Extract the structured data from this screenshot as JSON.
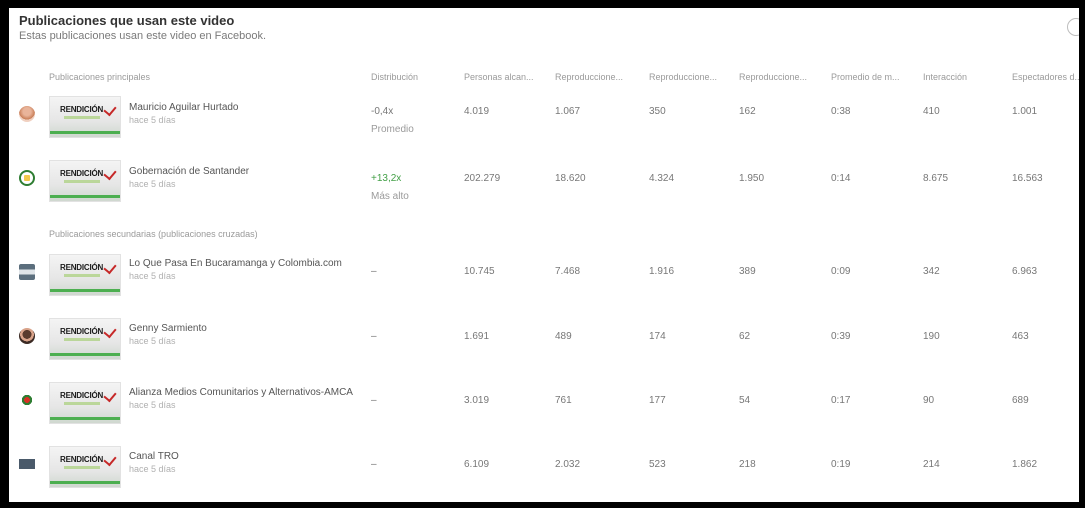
{
  "header": {
    "title": "Publicaciones que usan este video",
    "subtitle": "Estas publicaciones usan este video en Facebook."
  },
  "columns": [
    "Publicaciones principales",
    "Distribución",
    "Personas alcan...",
    "Reproduccione...",
    "Reproduccione...",
    "Reproduccione...",
    "Promedio de m...",
    "Interacción",
    "Espectadores d..."
  ],
  "primary_posts": [
    {
      "name": "Mauricio Aguilar Hurtado",
      "time": "hace 5 días",
      "thumb_text": "RENDICIÓN",
      "distribution": "-0,4x",
      "distribution_note": "Promedio",
      "values": [
        "4.019",
        "1.067",
        "350",
        "162",
        "0:38",
        "410",
        "1.001"
      ]
    },
    {
      "name": "Gobernación de Santander",
      "time": "hace 5 días",
      "thumb_text": "RENDICIÓN",
      "distribution": "+13,2x",
      "distribution_note": "Más alto",
      "values": [
        "202.279",
        "18.620",
        "4.324",
        "1.950",
        "0:14",
        "8.675",
        "16.563"
      ]
    }
  ],
  "secondary_label": "Publicaciones secundarias (publicaciones cruzadas)",
  "secondary_posts": [
    {
      "name": "Lo Que Pasa En Bucaramanga y Colombia.com",
      "time": "hace 5 días",
      "thumb_text": "RENDICIÓN",
      "distribution": "–",
      "values": [
        "10.745",
        "7.468",
        "1.916",
        "389",
        "0:09",
        "342",
        "6.963"
      ]
    },
    {
      "name": "Genny Sarmiento",
      "time": "hace 5 días",
      "thumb_text": "RENDICIÓN",
      "distribution": "–",
      "values": [
        "1.691",
        "489",
        "174",
        "62",
        "0:39",
        "190",
        "463"
      ]
    },
    {
      "name": "Alianza Medios Comunitarios y Alternativos-AMCA",
      "time": "hace 5 días",
      "thumb_text": "RENDICIÓN",
      "distribution": "–",
      "values": [
        "3.019",
        "761",
        "177",
        "54",
        "0:17",
        "90",
        "689"
      ]
    },
    {
      "name": "Canal TRO",
      "time": "hace 5 días",
      "thumb_text": "RENDICIÓN",
      "distribution": "–",
      "values": [
        "6.109",
        "2.032",
        "523",
        "218",
        "0:19",
        "214",
        "1.862"
      ]
    }
  ],
  "colors": {
    "positive": "#43a047",
    "muted_text": "#777777",
    "border": "#000000"
  },
  "icons": {
    "info": "info-icon"
  }
}
